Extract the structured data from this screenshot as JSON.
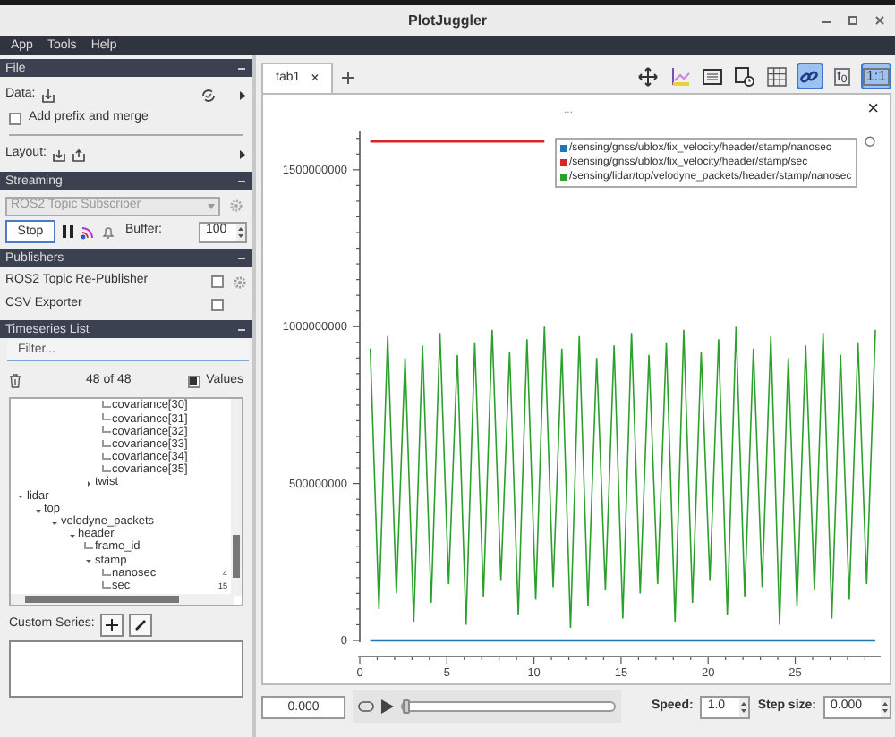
{
  "window": {
    "title": "PlotJuggler"
  },
  "menu": [
    "App",
    "Tools",
    "Help"
  ],
  "file": {
    "header": "File",
    "data_label": "Data:",
    "prefix_checkbox": {
      "label": "Add prefix and merge",
      "checked": false
    },
    "layout_label": "Layout:"
  },
  "streaming": {
    "header": "Streaming",
    "source": "ROS2 Topic Subscriber",
    "stop_button": "Stop",
    "buffer_label": "Buffer:",
    "buffer": "100"
  },
  "publishers": {
    "header": "Publishers",
    "items": [
      {
        "label": "ROS2 Topic Re-Publisher",
        "checked": false,
        "settings": true
      },
      {
        "label": "CSV Exporter",
        "checked": false,
        "settings": false
      }
    ]
  },
  "timeseries": {
    "header": "Timeseries List",
    "filter_placeholder": "Filter...",
    "count": "48 of 48",
    "values_checkbox": {
      "label": "Values",
      "checked": true
    },
    "tree": [
      {
        "expanded": true,
        "children": [
          {
            "expanded": true,
            "children": [
              {
                "expanded": true,
                "children": [
                  {
                    "expanded": true,
                    "children": [
                      {
                        "expanded": true,
                        "children": [
                          {
                            "label": "covariance[30]"
                          },
                          {
                            "label": "covariance[31]"
                          },
                          {
                            "label": "covariance[32]"
                          },
                          {
                            "label": "covariance[33]"
                          },
                          {
                            "label": "covariance[34]"
                          },
                          {
                            "label": "covariance[35]"
                          }
                        ]
                      },
                      {
                        "label": "twist",
                        "expanded": false
                      }
                    ]
                  }
                ]
              }
            ]
          }
        ]
      },
      {
        "label": "lidar",
        "expanded": true,
        "children": [
          {
            "label": "top",
            "expanded": true,
            "children": [
              {
                "label": "velodyne_packets",
                "expanded": true,
                "children": [
                  {
                    "label": "header",
                    "expanded": true,
                    "children": [
                      {
                        "label": "frame_id"
                      },
                      {
                        "label": "stamp",
                        "expanded": true,
                        "children": [
                          {
                            "label": "nanosec",
                            "value": "4"
                          },
                          {
                            "label": "sec",
                            "value": "15"
                          }
                        ]
                      }
                    ]
                  }
                ]
              }
            ]
          }
        ]
      }
    ]
  },
  "custom_series": {
    "label": "Custom Series:"
  },
  "tabs": [
    {
      "label": "tab1",
      "close": "×",
      "selected": true
    }
  ],
  "toolbar": [
    {
      "kind": "move",
      "selected": false
    },
    {
      "kind": "axes",
      "selected": false
    },
    {
      "kind": "legend",
      "selected": false
    },
    {
      "kind": "timer",
      "selected": false
    },
    {
      "kind": "grid",
      "selected": false
    },
    {
      "kind": "link",
      "selected": true
    },
    {
      "kind": "text",
      "label": "t$_{0}$",
      "selected": false
    },
    {
      "kind": "text",
      "label": "1:1",
      "selected": true
    }
  ],
  "plot": {
    "handle": "...",
    "close": "×",
    "chart_data": {
      "type": "line",
      "xlim": [
        0,
        29.7
      ],
      "ylim": [
        0,
        1625000000
      ],
      "xticks": [
        0,
        5,
        10,
        15,
        20,
        25
      ],
      "yticks": [
        0,
        500000000,
        1000000000,
        1500000000
      ],
      "x": [
        0.6,
        1.1,
        1.6,
        2.1,
        2.6,
        3.1,
        3.6,
        4.1,
        4.6,
        5.1,
        5.6,
        6.1,
        6.6,
        7.1,
        7.6,
        8.1,
        8.6,
        9.1,
        9.6,
        10.1,
        10.6,
        11.1,
        11.6,
        12.1,
        12.6,
        13.1,
        13.6,
        14.1,
        14.6,
        15.1,
        15.6,
        16.1,
        16.6,
        17.1,
        17.6,
        18.1,
        18.6,
        19.1,
        19.6,
        20.1,
        20.6,
        21.1,
        21.6,
        22.1,
        22.6,
        23.1,
        23.6,
        24.1,
        24.6,
        25.1,
        25.6,
        26.1,
        26.6,
        27.1,
        27.6,
        28.1,
        28.6,
        29.1,
        29.6
      ],
      "series": [
        {
          "name": "/sensing/gnss/ublox/fix_velocity/header/stamp/nanosec",
          "color": "#1f77b4",
          "values": [
            0,
            0,
            0,
            0,
            0,
            0,
            0,
            0,
            0,
            0,
            0,
            0,
            0,
            0,
            0,
            0,
            0,
            0,
            0,
            0,
            0,
            0,
            0,
            0,
            0,
            0,
            0,
            0,
            0,
            0,
            0,
            0,
            0,
            0,
            0,
            0,
            0,
            0,
            0,
            0,
            0,
            0,
            0,
            0,
            0,
            0,
            0,
            0,
            0,
            0,
            0,
            0,
            0,
            0,
            0,
            0,
            0,
            0,
            0
          ]
        },
        {
          "name": "/sensing/gnss/ublox/fix_velocity/header/stamp/sec",
          "color": "#d62728",
          "values": [
            1590000000,
            1590000000,
            1590000000,
            1590000000,
            1590000000,
            1590000000,
            1590000000,
            1590000000,
            1590000000,
            1590000000,
            1590000000,
            1590000000,
            1590000000,
            1590000000,
            1590000000,
            1590000000,
            1590000000,
            1590000000,
            1590000000,
            1590000000,
            1590000000,
            null,
            null,
            null,
            null,
            null,
            null,
            null,
            null,
            null,
            null,
            null,
            null,
            null,
            null,
            null,
            null,
            null,
            null,
            null,
            null,
            null,
            null,
            null,
            null,
            null,
            null,
            null,
            null,
            null,
            null,
            null,
            null,
            null,
            null,
            null,
            null,
            null,
            null
          ]
        },
        {
          "name": "/sensing/lidar/top/velodyne_packets/header/stamp/nanosec",
          "color": "#2ca02c",
          "values": [
            930000000,
            100000000,
            970000000,
            150000000,
            900000000,
            60000000,
            940000000,
            120000000,
            980000000,
            180000000,
            910000000,
            50000000,
            950000000,
            140000000,
            990000000,
            190000000,
            920000000,
            80000000,
            960000000,
            130000000,
            1000000000,
            170000000,
            930000000,
            40000000,
            970000000,
            110000000,
            900000000,
            160000000,
            940000000,
            70000000,
            980000000,
            150000000,
            910000000,
            180000000,
            950000000,
            60000000,
            990000000,
            120000000,
            920000000,
            190000000,
            960000000,
            80000000,
            1000000000,
            140000000,
            930000000,
            170000000,
            970000000,
            50000000,
            900000000,
            110000000,
            940000000,
            160000000,
            980000000,
            70000000,
            910000000,
            130000000,
            950000000,
            180000000,
            990000000
          ]
        }
      ]
    }
  },
  "playback": {
    "time": "0.000",
    "level": 0,
    "speed_label": "Speed:",
    "speed": "1.0",
    "step_label": "Step size:",
    "step": "0.000"
  }
}
